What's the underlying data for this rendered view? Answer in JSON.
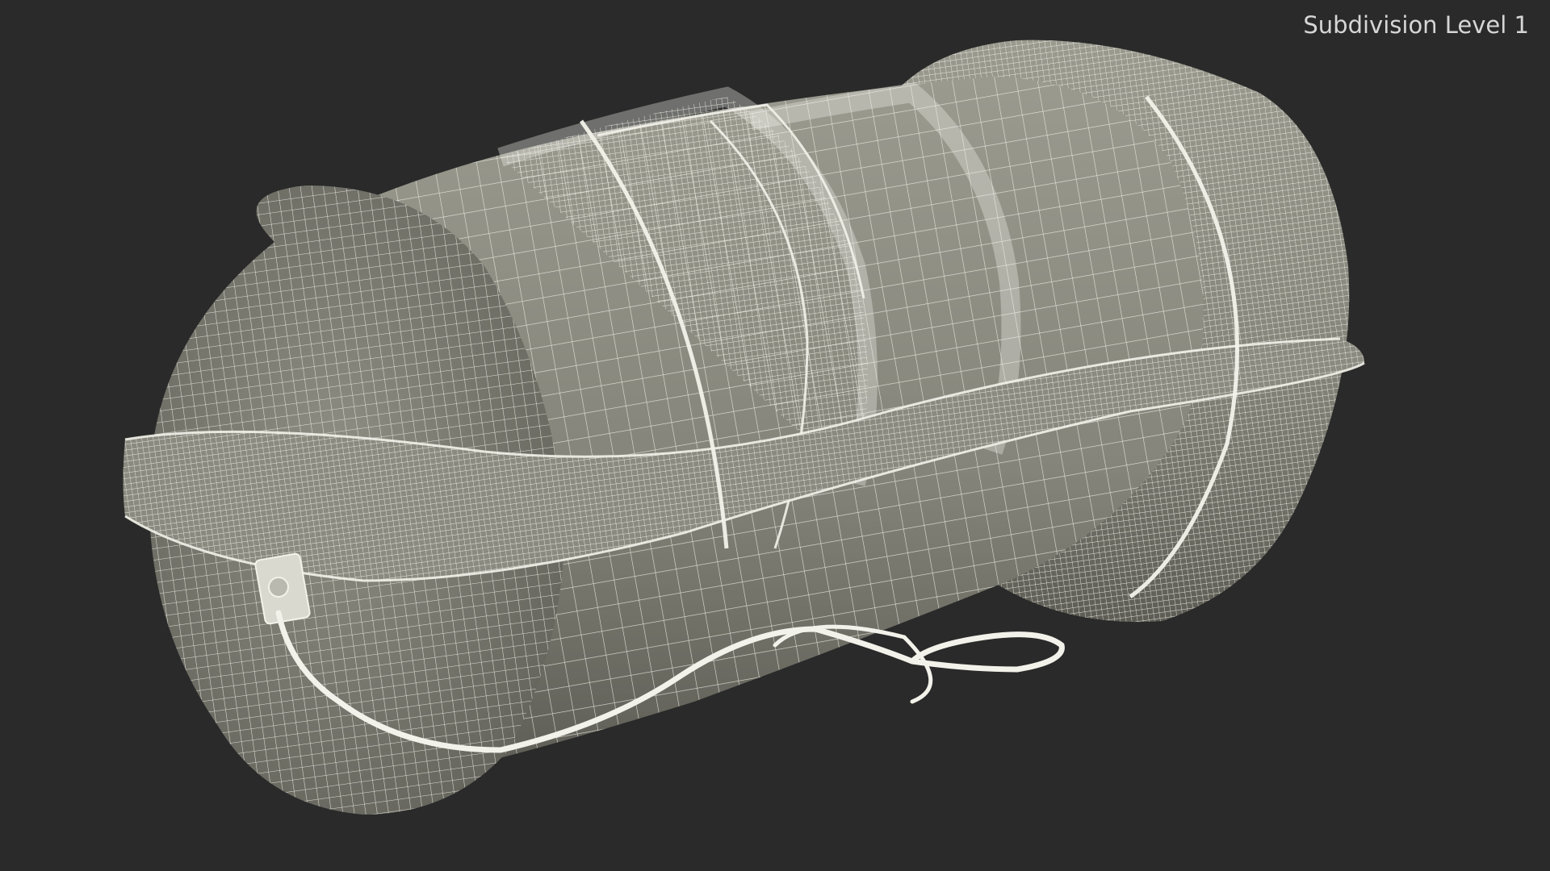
{
  "overlay": {
    "label": "Subdivision Level 1"
  },
  "colors": {
    "background": "#2a2a2a",
    "surface": "#8e8e84",
    "surface_shadow": "#5a5a52",
    "wire": "#f2f2ea",
    "label": "#d6d6d6"
  },
  "render": {
    "object": "liferaft-canister-wireframe-icon"
  }
}
